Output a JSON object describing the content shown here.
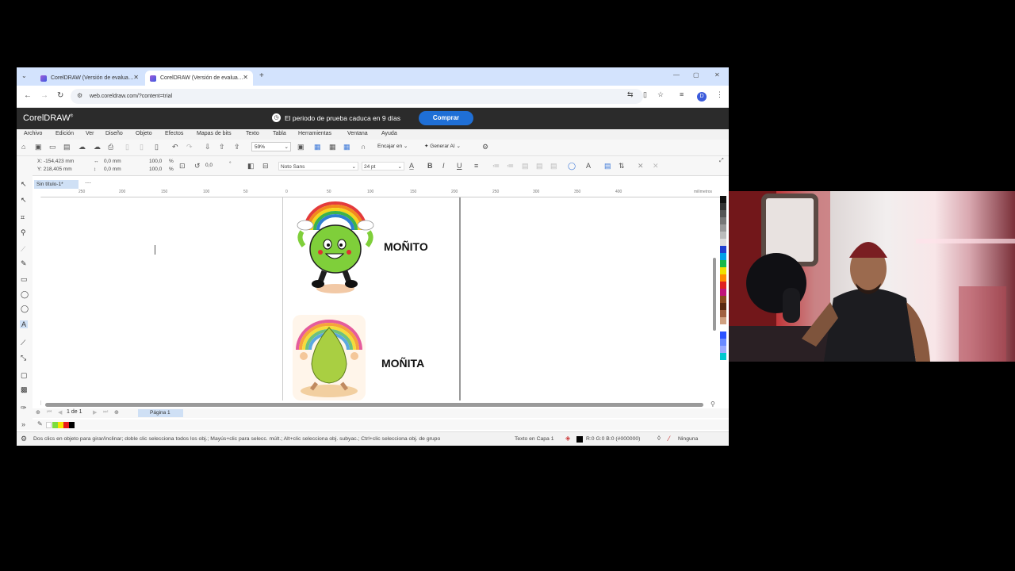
{
  "browser": {
    "tabs": [
      {
        "label": "CorelDRAW (Versión de evalua…",
        "active": false
      },
      {
        "label": "CorelDRAW (Versión de evalua…",
        "active": true
      }
    ],
    "new_tab": "+",
    "url": "web.coreldraw.com/?content=trial",
    "avatar_letter": "D"
  },
  "corel": {
    "logo": "CorelDRAW",
    "trial_message": "El periodo de prueba caduca en 9 días",
    "buy_button": "Comprar",
    "menu": [
      "Archivo",
      "Edición",
      "Ver",
      "Diseño",
      "Objeto",
      "Efectos",
      "Mapas de bits",
      "Texto",
      "Tabla",
      "Herramientas",
      "Ventana",
      "Ayuda"
    ],
    "toolbar": {
      "zoom": "59%",
      "snap": "Encajar en",
      "generate_ai": "Generar AI"
    },
    "propbar": {
      "x": "X: -154,423 mm",
      "y": "Y: 218,405 mm",
      "w": "0,0 mm",
      "h": "0,0 mm",
      "sx": "100,0",
      "sy": "100,0",
      "pct1": "%",
      "pct2": "%",
      "angle": "0,0",
      "deg": "°",
      "font": "Noto Sans",
      "size": "24 pt"
    },
    "doc_tab": "Sin título-1*",
    "ruler_labels": [
      "250",
      "200",
      "150",
      "100",
      "50",
      "0",
      "50",
      "100",
      "150",
      "200",
      "250",
      "300",
      "350",
      "400"
    ],
    "ruler_unit": "milímetros",
    "artwork": {
      "label_top": "MOÑITO",
      "label_bottom": "MOÑITA"
    },
    "page_nav": {
      "counter": "1 de 1",
      "page_tab": "Página 1"
    },
    "status": {
      "hint": "Dos clics en objeto para girar/inclinar; doble clic selecciona todos los obj.; Mayús+clic para selecc. múlt.; Alt+clic selecciona obj. subyac.; Ctrl+clic selecciona obj. de grupo",
      "layer": "Texto en Capa 1",
      "fill": "R:0 G:0 B:0 (#000000)",
      "outline": "Ninguna"
    },
    "palette_colors": [
      "#111111",
      "#333333",
      "#555555",
      "#777777",
      "#999999",
      "#bbbbbb",
      "#dddddd",
      "#1e3fd0",
      "#00a0e8",
      "#18b84a",
      "#f0e000",
      "#ff8a00",
      "#e02020",
      "#c0147a",
      "#8a4a20",
      "#5a2a10",
      "#a06040",
      "#d0a080",
      "#ffffff",
      "#2a52ff",
      "#6a8aff",
      "#9aaaff",
      "#00c8d0"
    ]
  }
}
